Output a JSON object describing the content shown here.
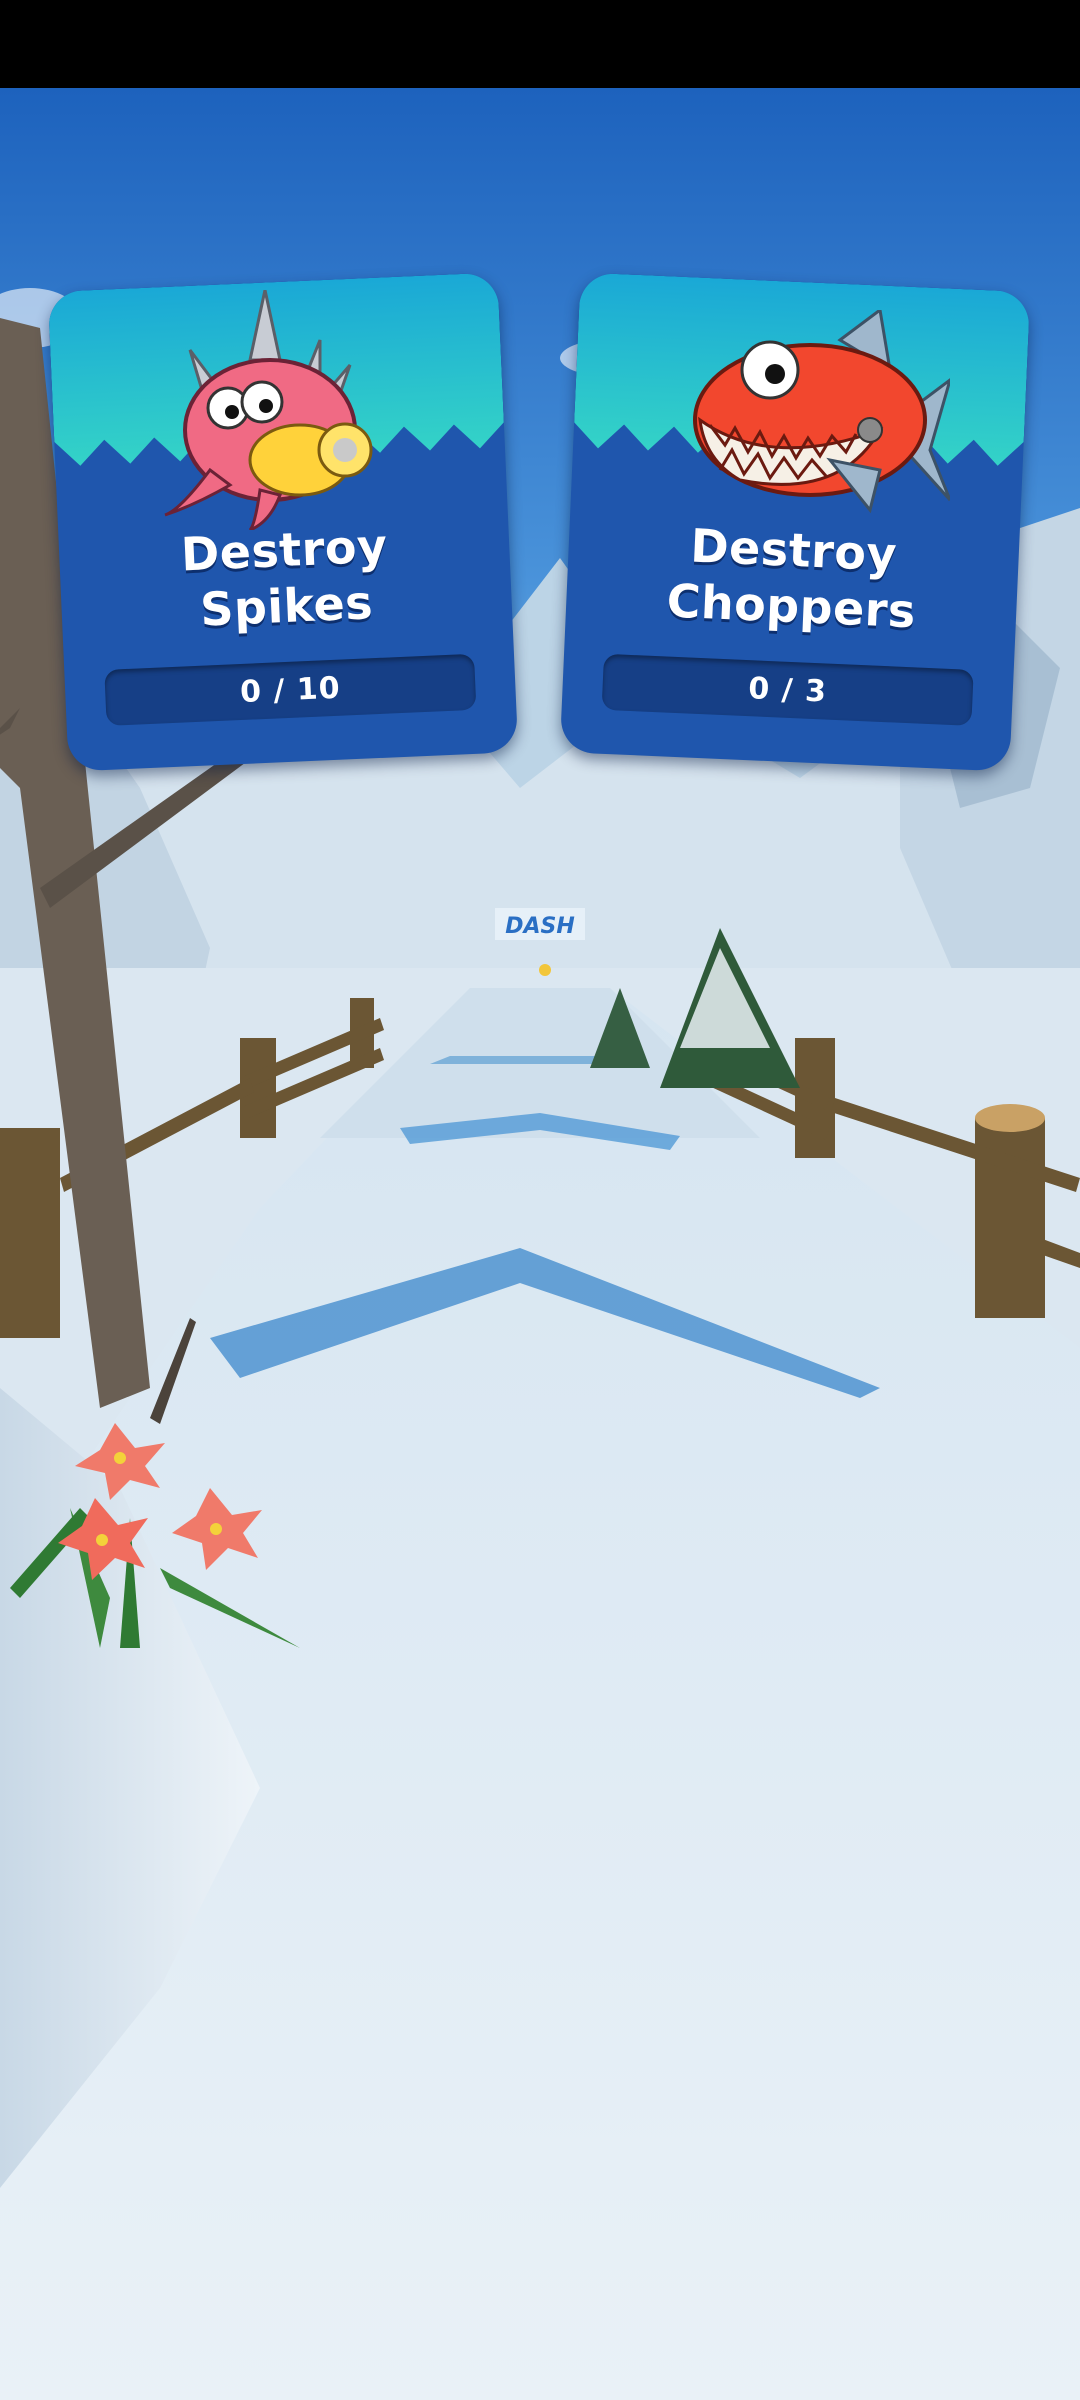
{
  "missions": [
    {
      "title_line1": "Destroy",
      "title_line2": "Spikes",
      "progress": "0 / 10",
      "enemy_icon": "spikes-badnik-icon"
    },
    {
      "title_line1": "Destroy",
      "title_line2": "Choppers",
      "progress": "0 / 3",
      "enemy_icon": "chopper-fish-icon"
    }
  ],
  "scene": {
    "banner_text": "DASH",
    "sky_color": "#2f7fd0",
    "snow_color": "#dfeaf3",
    "card_color": "#1f56ad",
    "card_top_color": "#1fa2c9"
  }
}
